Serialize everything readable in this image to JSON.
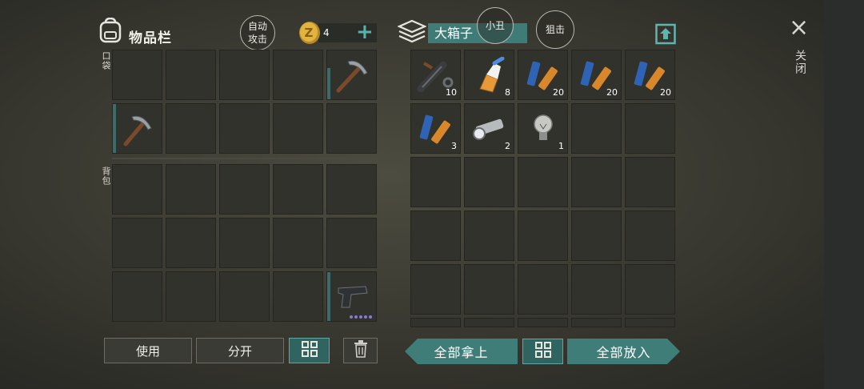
{
  "header": {
    "inventory_title": "物品栏",
    "auto_attack_label_1": "自动",
    "auto_attack_label_2": "攻击",
    "coin_count": "4",
    "add_label": "+",
    "container_title": "大箱子",
    "clown_label": "小丑",
    "snipe_label": "狙击"
  },
  "sections": {
    "pocket": "口袋",
    "backpack": "背包"
  },
  "container_items": [
    {
      "name": "scope",
      "qty": "10"
    },
    {
      "name": "glue",
      "qty": "8"
    },
    {
      "name": "batteries",
      "qty": "20"
    },
    {
      "name": "batteries",
      "qty": "20"
    },
    {
      "name": "batteries",
      "qty": "20"
    },
    {
      "name": "batteries",
      "qty": "3"
    },
    {
      "name": "flashlight",
      "qty": "2"
    },
    {
      "name": "light-bulb",
      "qty": "1"
    }
  ],
  "buttons": {
    "use": "使用",
    "split": "分开",
    "take_all": "全部拿上",
    "put_all": "全部放入"
  },
  "close": {
    "icon": "×",
    "label": "关闭"
  },
  "colors": {
    "accent_teal": "#3e7d78",
    "slot_bg": "#31322c",
    "rarity_dots": "#8b78d6"
  }
}
